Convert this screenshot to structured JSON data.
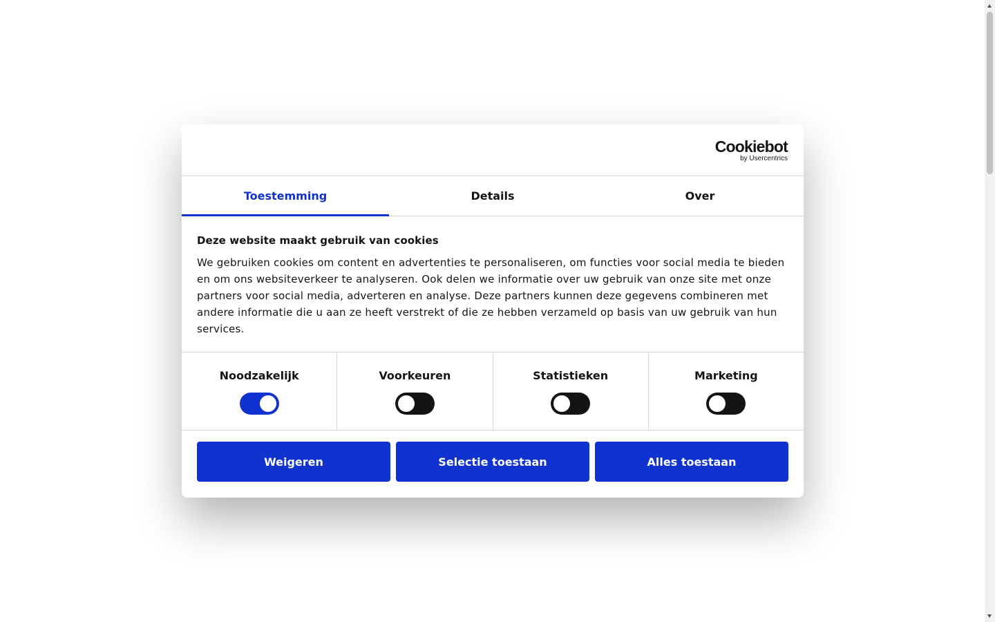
{
  "brand": {
    "name": "Cookiebot",
    "tagline": "by Usercentrics"
  },
  "tabs": [
    {
      "label": "Toestemming",
      "active": true
    },
    {
      "label": "Details",
      "active": false
    },
    {
      "label": "Over",
      "active": false
    }
  ],
  "consent": {
    "title": "Deze website maakt gebruik van cookies",
    "text": "We gebruiken cookies om content en advertenties te personaliseren, om functies voor social media te bieden en om ons websiteverkeer te analyseren. Ook delen we informatie over uw gebruik van onze site met onze partners voor social media, adverteren en analyse. Deze partners kunnen deze gegevens combineren met andere informatie die u aan ze heeft verstrekt of die ze hebben verzameld op basis van uw gebruik van hun services."
  },
  "categories": [
    {
      "label": "Noodzakelijk",
      "enabled": true
    },
    {
      "label": "Voorkeuren",
      "enabled": false
    },
    {
      "label": "Statistieken",
      "enabled": false
    },
    {
      "label": "Marketing",
      "enabled": false
    }
  ],
  "buttons": {
    "decline": "Weigeren",
    "allow_selection": "Selectie toestaan",
    "allow_all": "Alles toestaan"
  },
  "colors": {
    "accent": "#1032cf",
    "text": "#141414",
    "divider": "#d6d6d6",
    "toggle_off": "#141414"
  }
}
